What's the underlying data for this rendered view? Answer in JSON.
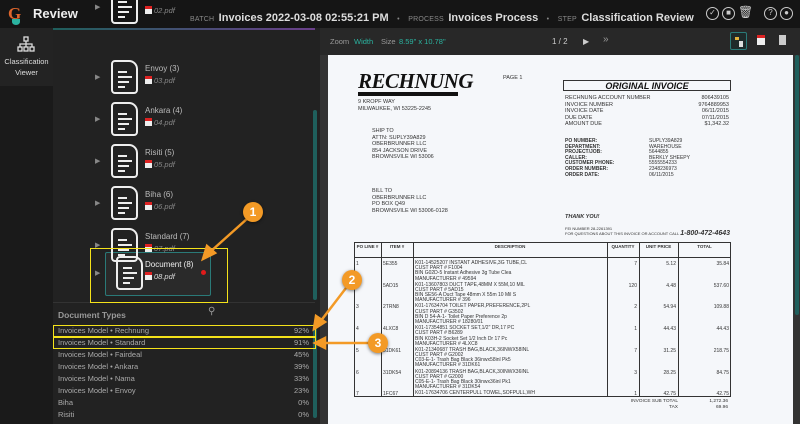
{
  "header": {
    "app_title": "Review",
    "batch_label": "BATCH",
    "batch_value": "Invoices 2022-03-08 02:55:21 PM",
    "process_label": "PROCESS",
    "process_value": "Invoices Process",
    "step_label": "STEP",
    "step_value": "Classification Review",
    "icons": [
      "check-circle-icon",
      "stop-circle-icon",
      "trash-icon",
      "help-icon",
      "user-icon"
    ]
  },
  "rail": {
    "item_label": "Classification Viewer",
    "icon": "hierarchy-icon"
  },
  "tree": {
    "items": [
      {
        "label": "",
        "file": "02.pdf"
      },
      {
        "label": "Envoy (3)",
        "file": "03.pdf"
      },
      {
        "label": "Ankara (4)",
        "file": "04.pdf"
      },
      {
        "label": "Risiti (5)",
        "file": "05.pdf"
      },
      {
        "label": "Biha (6)",
        "file": "06.pdf"
      },
      {
        "label": "Standard (7)",
        "file": "07.pdf"
      },
      {
        "label": "Document (8)",
        "file": "08.pdf"
      }
    ],
    "selected": "Document (8)"
  },
  "doc_types": {
    "title": "Document Types",
    "rows": [
      {
        "name": "Invoices Model • Rechnung",
        "pct": "92%"
      },
      {
        "name": "Invoices Model • Standard",
        "pct": "91%"
      },
      {
        "name": "Invoices Model • Fairdeal",
        "pct": "45%"
      },
      {
        "name": "Invoices Model • Ankara",
        "pct": "39%"
      },
      {
        "name": "Invoices Model • Nama",
        "pct": "33%"
      },
      {
        "name": "Invoices Model • Envoy",
        "pct": "23%"
      },
      {
        "name": "Biha",
        "pct": "0%"
      },
      {
        "name": "Risiti",
        "pct": "0%"
      }
    ]
  },
  "viewer": {
    "zoom_label": "Zoom",
    "zoom_value": "Width",
    "size_label": "Size",
    "size_value": "8.59\" x 10.78\"",
    "page": "1 / 2",
    "next": "▶",
    "last": "»"
  },
  "invoice": {
    "brand": "RECHNUNG",
    "page": "PAGE 1",
    "address": [
      "9 KROPF WAY",
      "MILWAUKEE, WI 53225-2245"
    ],
    "ship_to": [
      "SHIP TO",
      "ATTN: SUPLY39A829",
      "OBERBRUNNER LLC",
      "854 JACKSON DRIVE",
      "BROWNSVILE WI  53006"
    ],
    "bill_to": [
      "BILL TO",
      "OBERBRUNNER LLC",
      "PO BOX Q49",
      "BROWNSVILE WI  53006-0128"
    ],
    "title": "ORIGINAL INVOICE",
    "summary": [
      [
        "RECHNUNG ACCOUNT NUMBER",
        "806439105"
      ],
      [
        "INVOICE NUMBER",
        "9764889953"
      ],
      [
        "INVOICE DATE",
        "06/11/2015"
      ],
      [
        "DUE DATE",
        "07/11/2015"
      ],
      [
        "AMOUNT DUE",
        "$1,342.32"
      ]
    ],
    "details": [
      [
        "PO NUMBER:",
        "SUPLY39A829"
      ],
      [
        "DEPARTMENT:",
        "WAREHOUSE"
      ],
      [
        "PROJECT/JOB:",
        "5644855"
      ],
      [
        "CALLER:",
        "BERKLY SHEEPY"
      ],
      [
        "CUSTOMER PHONE:",
        "5555554233"
      ],
      [
        "ORDER NUMBER:",
        "2348236973"
      ],
      [
        "ORDER DATE:",
        "06/11/2015"
      ]
    ],
    "thanks": "THANK YOU!",
    "fei": "FEI NUMBER   28-2261391",
    "questions": "FOR QUESTIONS ABOUT THIS INVOICE OR ACCOUNT CALL",
    "phone": "1-800-472-4643",
    "columns": [
      "PO LINE #",
      "ITEM #",
      "DESCRIPTION",
      "QUANTITY",
      "UNIT PRICE",
      "TOTAL"
    ],
    "lines": [
      {
        "line": "1",
        "item": "5E355",
        "desc": [
          "K01-14525207 INSTANT ADHESIVE,3G TUBE,CL",
          "CUST PART # F1004",
          "BIN G02D-5 Instant Adhesive 3g Tube Clea",
          "MANUFACTURER # 49594"
        ],
        "qty": "7",
        "unit": "5.12",
        "total": "35.84"
      },
      {
        "line": "2",
        "item": "5AD15",
        "desc": [
          "K01-13607803 DUCT TAPE,48MM X 55M,10 MIL",
          "CUST PART # 5AD15",
          "BIN SE56-A Duct Tape 48mm X 55m 10 Mil S",
          "MANUFACTURER # 396"
        ],
        "qty": "120",
        "unit": "4.48",
        "total": "537.60"
      },
      {
        "line": "3",
        "item": "2TRN8",
        "desc": [
          "K01-17634704 TOILET PAPER,PREFERENCE,2PL",
          "CUST PART # G3502",
          "BIN D 54-A-1- Toilet Paper Preference 2p",
          "MANUFACTURER # 18280/01"
        ],
        "qty": "2",
        "unit": "54.94",
        "total": "109.88"
      },
      {
        "line": "4",
        "item": "4LXC8",
        "desc": [
          "K01-17354851 SOCKET SET,1/2\" DR,17 PC",
          "CUST PART # B6289",
          "BIN K03H-2 Socket Set 1/2 Inch  Dr 17 Pc",
          "MANUFACTURER # 4LXC8"
        ],
        "qty": "1",
        "unit": "44.43",
        "total": "44.43"
      },
      {
        "line": "5",
        "item": "31DK61",
        "desc": [
          "K01-21340687 TRASH BAG,BLACK,36INWX58INL",
          "CUST PART # G2002",
          "C03-E-1- Trash Bag Black 36inwx58inl Pk5",
          "MANUFACTURER # 31DK61"
        ],
        "qty": "7",
        "unit": "31.25",
        "total": "218.75"
      },
      {
        "line": "6",
        "item": "31DK54",
        "desc": [
          "K01-20894136 TRASH BAG,BLACK,30INWX36INL",
          "CUST PART # G2000",
          "C05-E-1- Trash Bag Black 30inwx36inl Pk1",
          "MANUFACTURER # 31DK54"
        ],
        "qty": "3",
        "unit": "28.25",
        "total": "84.75"
      },
      {
        "line": "7",
        "item": "1FC67",
        "desc": [
          "K01-17634706 CENTERPULL TOWEL,SOFPULL,WH"
        ],
        "qty": "1",
        "unit": "42.75",
        "total": "42.75"
      }
    ],
    "subtotal_label": "INVOICE SUB TOTAL",
    "subtotal": "1,272.36",
    "tax_label": "TAX",
    "tax": "69.96"
  },
  "callouts": [
    "1",
    "2",
    "3"
  ],
  "colors": {
    "accent": "#2bb3a0",
    "highlight": "#f4e21a",
    "callout": "#f39a26",
    "status_dot": "#e01b1b"
  }
}
